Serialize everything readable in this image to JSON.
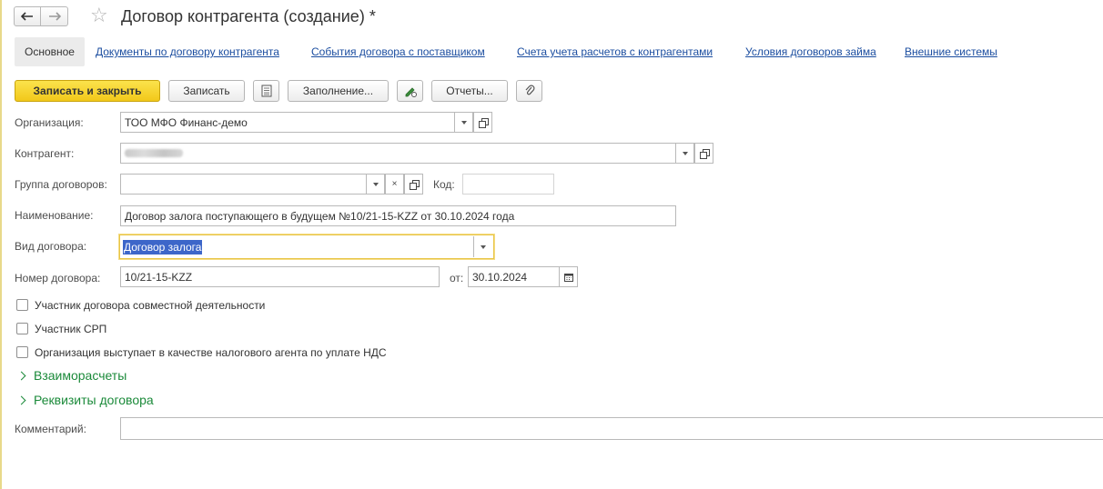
{
  "title": "Договор контрагента (создание) *",
  "nav": {
    "back_icon": "arrow-left-icon",
    "forward_icon": "arrow-right-icon",
    "favorite_icon": "star-icon"
  },
  "tabs": {
    "active": "Основное",
    "links": [
      "Документы по договору контрагента",
      "События договора с поставщиком",
      "Счета учета расчетов с контрагентами",
      "Условия договоров займа",
      "Внешние системы"
    ]
  },
  "toolbar": {
    "save_close": "Записать и закрыть",
    "save": "Записать",
    "fill": "Заполнение...",
    "reports": "Отчеты...",
    "icons": [
      "document-list-icon",
      "edit-attachment-icon",
      "paperclip-icon"
    ]
  },
  "form": {
    "org_label": "Организация:",
    "org_value": "ТОО МФО Финанс-демо",
    "counterparty_label": "Контрагент:",
    "group_label": "Группа договоров:",
    "group_value": "",
    "code_label": "Код:",
    "code_value": "",
    "name_label": "Наименование:",
    "name_value": "Договор залога поступающего в будущем №10/21-15-KZZ от 30.10.2024 года",
    "kind_label": "Вид договора:",
    "kind_value": "Договор залога",
    "number_label": "Номер договора:",
    "number_value": "10/21-15-KZZ",
    "date_label": "от:",
    "date_value": "30.10.2024",
    "checkboxes": [
      "Участник договора совместной деятельности",
      "Участник СРП",
      "Организация выступает в качестве налогового агента по уплате НДС"
    ],
    "groups": [
      "Взаиморасчеты",
      "Реквизиты договора"
    ],
    "comment_label": "Комментарий:",
    "comment_value": ""
  },
  "colors": {
    "primary_button": "#f5d22b",
    "link": "#1c4ea0",
    "group": "#1b8a3a",
    "focus": "#e8c547"
  }
}
